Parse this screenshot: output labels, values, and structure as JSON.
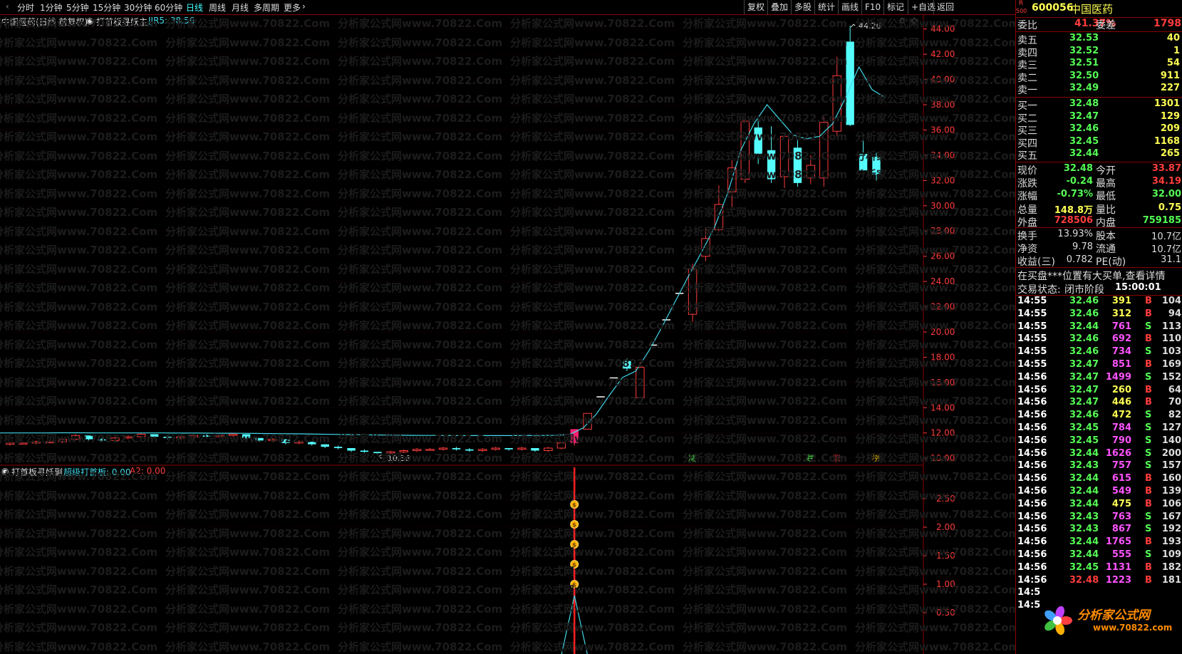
{
  "toolbar": {
    "period_tabs": [
      "分时",
      "1分钟",
      "5分钟",
      "15分钟",
      "30分钟",
      "60分钟",
      "日线",
      "周线",
      "月线",
      "多周期",
      "更多"
    ],
    "active_tab": "日线",
    "right_buttons": [
      "复权",
      "叠加",
      "多股",
      "统计",
      "画线",
      "F10",
      "标记",
      "+自选",
      "返回"
    ]
  },
  "chart_header": {
    "stock_label": "中国医药(日线 前复权)",
    "indicator_name": "打首板寻妖主",
    "indicator_value": "JJR5: 38.56"
  },
  "sub_header": {
    "indicator_name": "打首板寻妖副",
    "line1": "超级打首板: 0.00",
    "line2": "A2: 0.00"
  },
  "watermark": "分析家公式网www.70822.Com",
  "logo": {
    "line1": "分析家公式网",
    "line2": "www.70822.com"
  },
  "colors": {
    "up": "#ff3c3c",
    "down": "#54fcfc",
    "line": "#40d8e8",
    "axis_red": "#ff3c3c",
    "grid": "#8b0000"
  },
  "chart_data": {
    "type": "candlestick",
    "main_axis": {
      "ylim": [
        9.5,
        45
      ],
      "ticks": [
        "44.00",
        "42.00",
        "40.00",
        "38.00",
        "36.00",
        "34.00",
        "32.00",
        "30.00",
        "28.00",
        "26.00",
        "24.00",
        "22.00",
        "20.00",
        "18.00",
        "16.00",
        "14.00",
        "12.00",
        "10.00"
      ]
    },
    "sub_axis": {
      "ylim": [
        0,
        2.8
      ],
      "ticks": [
        "2.50",
        "2.00",
        "1.50",
        "1.00",
        "0.50"
      ]
    },
    "candles": [
      [
        11.1,
        11.2,
        11.0,
        11.2
      ],
      [
        11.2,
        11.3,
        11.1,
        11.2
      ],
      [
        11.2,
        11.4,
        11.1,
        11.3
      ],
      [
        11.3,
        11.4,
        11.2,
        11.3
      ],
      [
        11.3,
        11.5,
        11.2,
        11.5
      ],
      [
        11.5,
        11.9,
        11.4,
        11.8
      ],
      [
        11.8,
        11.8,
        11.4,
        11.5
      ],
      [
        11.5,
        11.6,
        11.3,
        11.4
      ],
      [
        11.4,
        11.7,
        11.3,
        11.6
      ],
      [
        11.6,
        11.8,
        11.5,
        11.7
      ],
      [
        11.7,
        12.0,
        11.6,
        11.9
      ],
      [
        11.9,
        11.9,
        11.6,
        11.7
      ],
      [
        11.7,
        11.8,
        11.5,
        11.6
      ],
      [
        11.6,
        11.8,
        11.5,
        11.7
      ],
      [
        11.7,
        11.9,
        11.6,
        11.8
      ],
      [
        11.8,
        11.9,
        11.6,
        11.7
      ],
      [
        11.7,
        11.9,
        11.6,
        11.8
      ],
      [
        11.8,
        12.0,
        11.7,
        11.9
      ],
      [
        11.9,
        11.9,
        11.5,
        11.6
      ],
      [
        11.6,
        11.6,
        11.3,
        11.4
      ],
      [
        11.4,
        11.6,
        11.3,
        11.5
      ],
      [
        11.5,
        11.5,
        11.1,
        11.2
      ],
      [
        11.2,
        11.4,
        11.1,
        11.3
      ],
      [
        11.3,
        11.3,
        11.0,
        11.1
      ],
      [
        11.1,
        11.1,
        10.8,
        10.9
      ],
      [
        10.9,
        11.0,
        10.7,
        10.8
      ],
      [
        10.8,
        10.8,
        10.5,
        10.6
      ],
      [
        10.6,
        10.7,
        10.4,
        10.5
      ],
      [
        10.5,
        10.5,
        10.36,
        10.4
      ],
      [
        10.4,
        10.6,
        10.36,
        10.5
      ],
      [
        10.5,
        10.7,
        10.4,
        10.6
      ],
      [
        10.6,
        10.8,
        10.5,
        10.7
      ],
      [
        10.7,
        10.8,
        10.6,
        10.7
      ],
      [
        10.7,
        10.9,
        10.6,
        10.8
      ],
      [
        10.8,
        10.9,
        10.6,
        10.7
      ],
      [
        10.7,
        10.8,
        10.5,
        10.6
      ],
      [
        10.6,
        10.8,
        10.5,
        10.7
      ],
      [
        10.7,
        10.9,
        10.6,
        10.8
      ],
      [
        10.8,
        10.8,
        10.6,
        10.7
      ],
      [
        10.7,
        10.9,
        10.6,
        10.8
      ],
      [
        10.8,
        10.8,
        10.5,
        10.6
      ],
      [
        10.6,
        10.9,
        10.5,
        10.8
      ],
      [
        10.8,
        11.3,
        10.7,
        11.2
      ],
      [
        11.2,
        12.3,
        11.0,
        12.3
      ],
      [
        12.3,
        13.55,
        12.3,
        13.55
      ],
      [
        14.9,
        14.9,
        14.9,
        14.9
      ],
      [
        16.4,
        16.4,
        16.4,
        16.4
      ],
      [
        17.7,
        17.9,
        16.9,
        17.1
      ],
      [
        14.8,
        17.6,
        14.8,
        17.2
      ],
      [
        19.0,
        19.0,
        19.0,
        19.0
      ],
      [
        21.0,
        21.0,
        21.0,
        21.0
      ],
      [
        23.1,
        23.1,
        23.1,
        23.1
      ],
      [
        21.4,
        25.4,
        20.8,
        25.0
      ],
      [
        26.0,
        28.3,
        25.6,
        27.4
      ],
      [
        28.1,
        31.6,
        28.0,
        30.1
      ],
      [
        31.1,
        33.6,
        29.8,
        33.0
      ],
      [
        32.1,
        37.0,
        31.8,
        36.7
      ],
      [
        36.2,
        37.0,
        33.3,
        34.1
      ],
      [
        34.4,
        36.3,
        31.8,
        32.1
      ],
      [
        32.3,
        35.8,
        31.4,
        35.5
      ],
      [
        34.6,
        35.3,
        31.5,
        31.8
      ],
      [
        32.2,
        34.0,
        31.7,
        33.2
      ],
      [
        32.2,
        37.0,
        31.5,
        36.6
      ],
      [
        35.9,
        41.8,
        35.5,
        40.3
      ],
      [
        43.0,
        44.26,
        36.3,
        36.4
      ],
      [
        34.1,
        35.6,
        32.8,
        32.8
      ],
      [
        33.87,
        34.19,
        32.0,
        32.48
      ]
    ],
    "jjr5": [
      12.0,
      12.0,
      12.0,
      12.0,
      12.01,
      12.01,
      12.01,
      12.0,
      12.0,
      12.0,
      12.0,
      12.0,
      12.0,
      11.99,
      11.99,
      11.99,
      11.98,
      11.98,
      11.97,
      11.96,
      11.95,
      11.94,
      11.93,
      11.92,
      11.9,
      11.89,
      11.87,
      11.86,
      11.84,
      11.83,
      11.82,
      11.81,
      11.8,
      11.8,
      11.79,
      11.79,
      11.79,
      11.79,
      11.79,
      11.79,
      11.79,
      11.8,
      11.8,
      11.9,
      12.4,
      13.5,
      15.0,
      16.4,
      16.9,
      18.5,
      20.4,
      22.4,
      24.4,
      26.3,
      28.3,
      31.0,
      34.4,
      36.5,
      38.0,
      36.8,
      35.6,
      35.3,
      35.5,
      36.5,
      38.6,
      41.0,
      39.2,
      38.56
    ],
    "markers": [
      "减",
      "跌",
      "涨",
      "榜"
    ],
    "annotations": [
      "44.26",
      "10.36"
    ],
    "signal": {
      "dots": [
        2.4,
        2.05,
        1.7,
        1.35,
        1.0
      ],
      "spike_height": 2.8
    }
  },
  "quote": {
    "code": "600056",
    "name": "中国医药",
    "r_badge": "R",
    "r_badge_sub": "500",
    "weibi_label": "委比",
    "weibi": "41.37%",
    "weicha_label": "委差",
    "weicha": "1798",
    "sells": [
      {
        "label": "卖五",
        "price": "32.53",
        "vol": "40"
      },
      {
        "label": "卖四",
        "price": "32.52",
        "vol": "1"
      },
      {
        "label": "卖三",
        "price": "32.51",
        "vol": "54"
      },
      {
        "label": "卖二",
        "price": "32.50",
        "vol": "911"
      },
      {
        "label": "卖一",
        "price": "32.49",
        "vol": "227"
      }
    ],
    "buys": [
      {
        "label": "买一",
        "price": "32.48",
        "vol": "1301"
      },
      {
        "label": "买二",
        "price": "32.47",
        "vol": "129"
      },
      {
        "label": "买三",
        "price": "32.46",
        "vol": "209"
      },
      {
        "label": "买四",
        "price": "32.45",
        "vol": "1168"
      },
      {
        "label": "买五",
        "price": "32.44",
        "vol": "265"
      }
    ],
    "stats": [
      {
        "l1": "现价",
        "v1": "32.48",
        "l2": "今开",
        "v2": "33.87",
        "c1": "#54fc54",
        "c2": "#ff3c3c"
      },
      {
        "l1": "涨跌",
        "v1": "-0.24",
        "l2": "最高",
        "v2": "34.19",
        "c1": "#54fc54",
        "c2": "#ff3c3c"
      },
      {
        "l1": "涨幅",
        "v1": "-0.73%",
        "l2": "最低",
        "v2": "32.00",
        "c1": "#54fc54",
        "c2": "#54fc54"
      },
      {
        "l1": "总量",
        "v1": "148.8万",
        "l2": "量比",
        "v2": "0.75",
        "c1": "#ffff54",
        "c2": "#ffff54"
      },
      {
        "l1": "外盘",
        "v1": "728506",
        "l2": "内盘",
        "v2": "759185",
        "c1": "#ff3c3c",
        "c2": "#54fc54"
      }
    ],
    "stats2": [
      {
        "l1": "换手",
        "v1": "13.93%",
        "l2": "股本",
        "v2": "10.7亿"
      },
      {
        "l1": "净资",
        "v1": "9.78",
        "l2": "流通",
        "v2": "10.7亿"
      },
      {
        "l1": "收益(三)",
        "v1": "0.782",
        "l2": "PE(动)",
        "v2": "31.1"
      }
    ],
    "notice": "在买盘***位置有大买单,查看详情",
    "trade_status_label": "交易状态:",
    "trade_status": "闭市阶段",
    "trade_time": "15:00:01"
  },
  "ticks": [
    {
      "t": "14:55",
      "p": "32.46",
      "v": "391",
      "bs": "B",
      "n": "104"
    },
    {
      "t": "14:55",
      "p": "32.46",
      "v": "312",
      "bs": "B",
      "n": "94"
    },
    {
      "t": "14:55",
      "p": "32.44",
      "v": "761",
      "bs": "S",
      "n": "113"
    },
    {
      "t": "14:55",
      "p": "32.46",
      "v": "692",
      "bs": "B",
      "n": "110"
    },
    {
      "t": "14:55",
      "p": "32.46",
      "v": "734",
      "bs": "S",
      "n": "103"
    },
    {
      "t": "14:55",
      "p": "32.47",
      "v": "851",
      "bs": "B",
      "n": "169"
    },
    {
      "t": "14:56",
      "p": "32.47",
      "v": "1499",
      "bs": "S",
      "n": "152"
    },
    {
      "t": "14:56",
      "p": "32.47",
      "v": "260",
      "bs": "B",
      "n": "64"
    },
    {
      "t": "14:56",
      "p": "32.47",
      "v": "446",
      "bs": "B",
      "n": "70"
    },
    {
      "t": "14:56",
      "p": "32.46",
      "v": "472",
      "bs": "S",
      "n": "82"
    },
    {
      "t": "14:56",
      "p": "32.45",
      "v": "784",
      "bs": "S",
      "n": "127"
    },
    {
      "t": "14:56",
      "p": "32.45",
      "v": "790",
      "bs": "S",
      "n": "140"
    },
    {
      "t": "14:56",
      "p": "32.44",
      "v": "1626",
      "bs": "S",
      "n": "200"
    },
    {
      "t": "14:56",
      "p": "32.43",
      "v": "757",
      "bs": "S",
      "n": "157"
    },
    {
      "t": "14:56",
      "p": "32.44",
      "v": "615",
      "bs": "B",
      "n": "160"
    },
    {
      "t": "14:56",
      "p": "32.44",
      "v": "549",
      "bs": "B",
      "n": "139"
    },
    {
      "t": "14:56",
      "p": "32.44",
      "v": "475",
      "bs": "B",
      "n": "106"
    },
    {
      "t": "14:56",
      "p": "32.43",
      "v": "763",
      "bs": "S",
      "n": "167"
    },
    {
      "t": "14:56",
      "p": "32.43",
      "v": "867",
      "bs": "S",
      "n": "192"
    },
    {
      "t": "14:56",
      "p": "32.44",
      "v": "1765",
      "bs": "B",
      "n": "193"
    },
    {
      "t": "14:56",
      "p": "32.44",
      "v": "555",
      "bs": "S",
      "n": "109"
    },
    {
      "t": "14:56",
      "p": "32.45",
      "v": "1131",
      "bs": "B",
      "n": "182"
    },
    {
      "t": "14:56",
      "p": "32.48",
      "v": "1223",
      "bs": "B",
      "n": "181"
    },
    {
      "t": "14:5",
      "p": "",
      "v": "",
      "bs": "",
      "n": ""
    },
    {
      "t": "14:5",
      "p": "",
      "v": "",
      "bs": "",
      "n": ""
    }
  ]
}
